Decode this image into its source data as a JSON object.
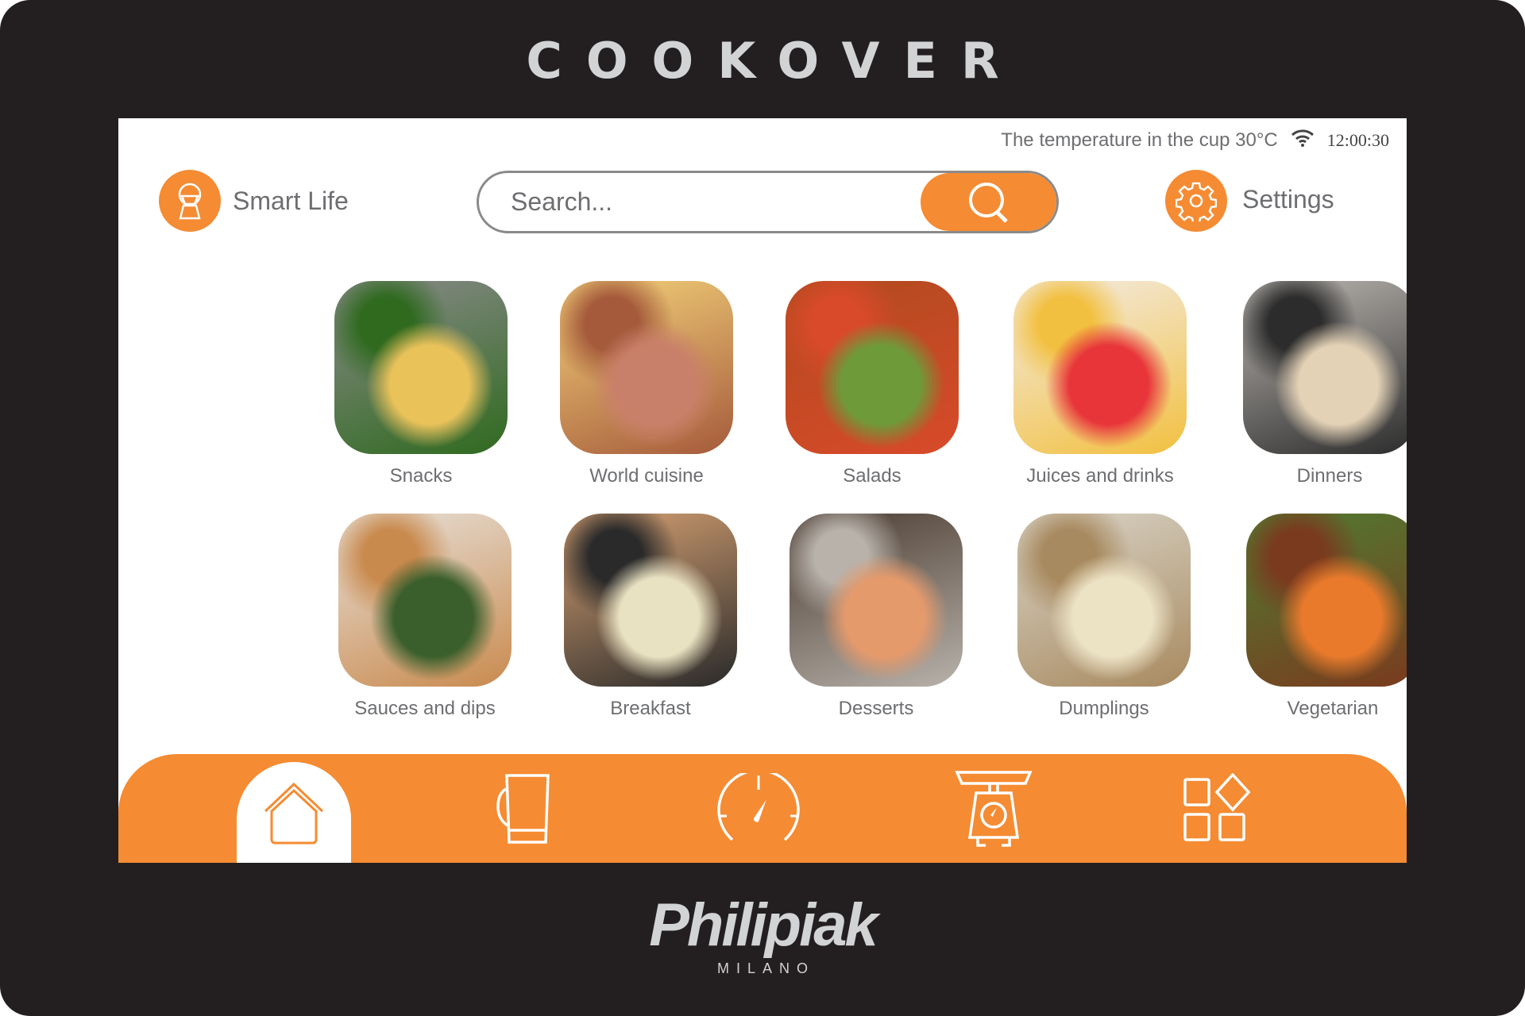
{
  "device": {
    "brand": "COOKOVER",
    "maker": "Philipiak",
    "maker_sub": "MILANO"
  },
  "status": {
    "temperature_text": "The temperature in the cup 30°C",
    "wifi_icon": "wifi-icon",
    "clock": "12:00:30"
  },
  "header": {
    "smart_life_label": "Smart Life",
    "search_placeholder": "Search...",
    "search_value": "",
    "settings_label": "Settings"
  },
  "categories": [
    {
      "label": "Snacks",
      "colors": [
        "#8a8a8a",
        "#e9c25a",
        "#2f6a1f"
      ]
    },
    {
      "label": "World cuisine",
      "colors": [
        "#f3d27a",
        "#c9806a",
        "#a55a3b"
      ]
    },
    {
      "label": "Salads",
      "colors": [
        "#b04a1e",
        "#6f9a3a",
        "#d84a2a"
      ]
    },
    {
      "label": "Juices and drinks",
      "colors": [
        "#f3ece6",
        "#e8353a",
        "#f2c040"
      ]
    },
    {
      "label": "Dinners",
      "colors": [
        "#bdb8b3",
        "#e4d2b6",
        "#2c2c2c"
      ]
    },
    {
      "label": "Sauces and dips",
      "colors": [
        "#e7e1da",
        "#3b5f2c",
        "#c98a4e"
      ]
    },
    {
      "label": "Breakfast",
      "colors": [
        "#d8a273",
        "#e9e2c2",
        "#2a2a2a"
      ]
    },
    {
      "label": "Desserts",
      "colors": [
        "#4a3b30",
        "#e59a6c",
        "#b8b2ab"
      ]
    },
    {
      "label": "Dumplings",
      "colors": [
        "#d9d4c8",
        "#ece2c4",
        "#a88a60"
      ]
    },
    {
      "label": "Vegetarian",
      "colors": [
        "#4f7d32",
        "#e97a2c",
        "#7a3a1e"
      ]
    }
  ],
  "nav": [
    {
      "name": "home",
      "icon": "home-icon",
      "active": true
    },
    {
      "name": "cup",
      "icon": "cup-icon",
      "active": false
    },
    {
      "name": "speed",
      "icon": "gauge-icon",
      "active": false
    },
    {
      "name": "scale",
      "icon": "scale-icon",
      "active": false
    },
    {
      "name": "apps",
      "icon": "apps-icon",
      "active": false
    }
  ],
  "colors": {
    "accent": "#f58b32",
    "bezel": "#231f20",
    "text": "#6d6e71"
  }
}
